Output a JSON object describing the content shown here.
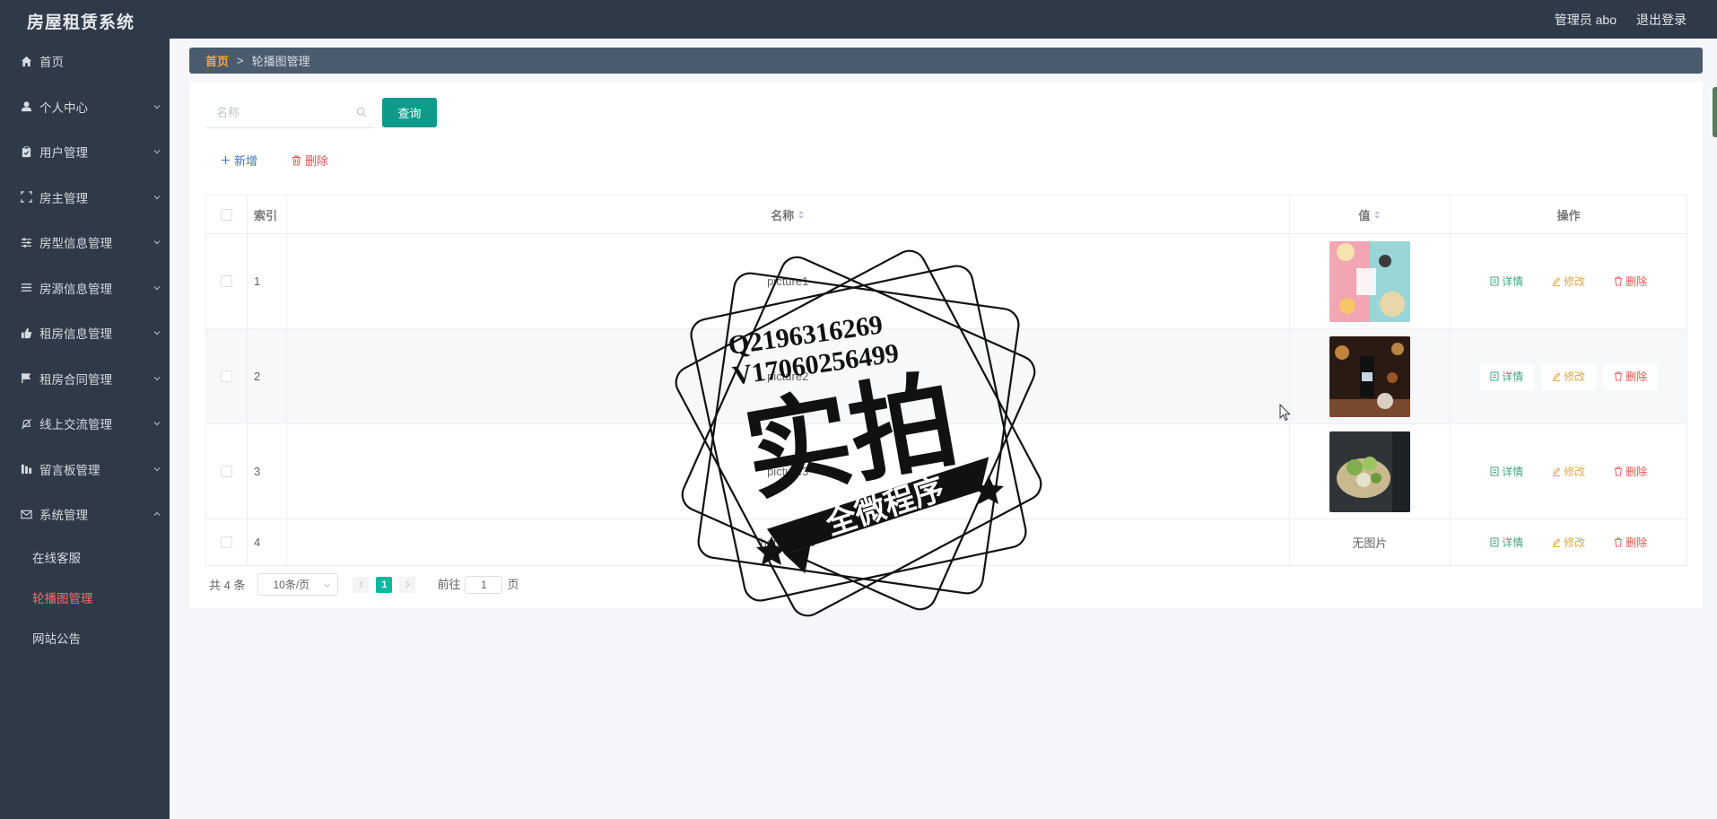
{
  "header": {
    "brand": "房屋租赁系统",
    "user": "管理员 abo",
    "logout": "退出登录"
  },
  "sidebar": {
    "items": [
      {
        "label": "首页",
        "icon": "home-icon",
        "expandable": false
      },
      {
        "label": "个人中心",
        "icon": "user-icon",
        "expandable": true
      },
      {
        "label": "用户管理",
        "icon": "clipboard-icon",
        "expandable": true
      },
      {
        "label": "房主管理",
        "icon": "frame-icon",
        "expandable": true
      },
      {
        "label": "房型信息管理",
        "icon": "sliders-icon",
        "expandable": true
      },
      {
        "label": "房源信息管理",
        "icon": "list-icon",
        "expandable": true
      },
      {
        "label": "租房信息管理",
        "icon": "thumb-up-icon",
        "expandable": true
      },
      {
        "label": "租房合同管理",
        "icon": "flag-icon",
        "expandable": true
      },
      {
        "label": "线上交流管理",
        "icon": "bell-off-icon",
        "expandable": true
      },
      {
        "label": "留言板管理",
        "icon": "bar-chart-icon",
        "expandable": true
      },
      {
        "label": "系统管理",
        "icon": "mail-icon",
        "expandable": true,
        "expanded": true
      }
    ],
    "subitems": [
      {
        "label": "在线客服",
        "active": false
      },
      {
        "label": "轮播图管理",
        "active": true
      },
      {
        "label": "网站公告",
        "active": false
      }
    ]
  },
  "breadcrumb": {
    "home": "首页",
    "separator": ">",
    "current": "轮播图管理"
  },
  "search": {
    "placeholder": "名称",
    "button": "查询"
  },
  "actions": {
    "add": "新增",
    "delete": "删除"
  },
  "table": {
    "headers": {
      "index": "索引",
      "name": "名称",
      "value": "值",
      "ops": "操作"
    },
    "rows": [
      {
        "index": "1",
        "name": "picture1",
        "value": "image"
      },
      {
        "index": "2",
        "name": "picture2",
        "value": "image"
      },
      {
        "index": "3",
        "name": "picture3",
        "value": "image"
      },
      {
        "index": "4",
        "name": "homepage",
        "value": "无图片"
      }
    ],
    "ops": {
      "detail": "详情",
      "edit": "修改",
      "delete": "删除"
    }
  },
  "pagination": {
    "total": "共 4 条",
    "page_size": "10条/页",
    "current": "1",
    "goto_prefix": "前往",
    "goto_value": "1",
    "goto_suffix": "页"
  },
  "watermark": {
    "line1": "Q2196316269",
    "line2": "V17060256499",
    "main": "实拍",
    "banner": "全微程序"
  },
  "colors": {
    "sidebar_bg": "#2f3a49",
    "primary": "#0e9b8a",
    "active_menu": "#ff6b6b",
    "breadcrumb_home": "#f4a93a",
    "danger": "#e0554d",
    "warning": "#e8a83c",
    "success": "#3fa67a"
  }
}
